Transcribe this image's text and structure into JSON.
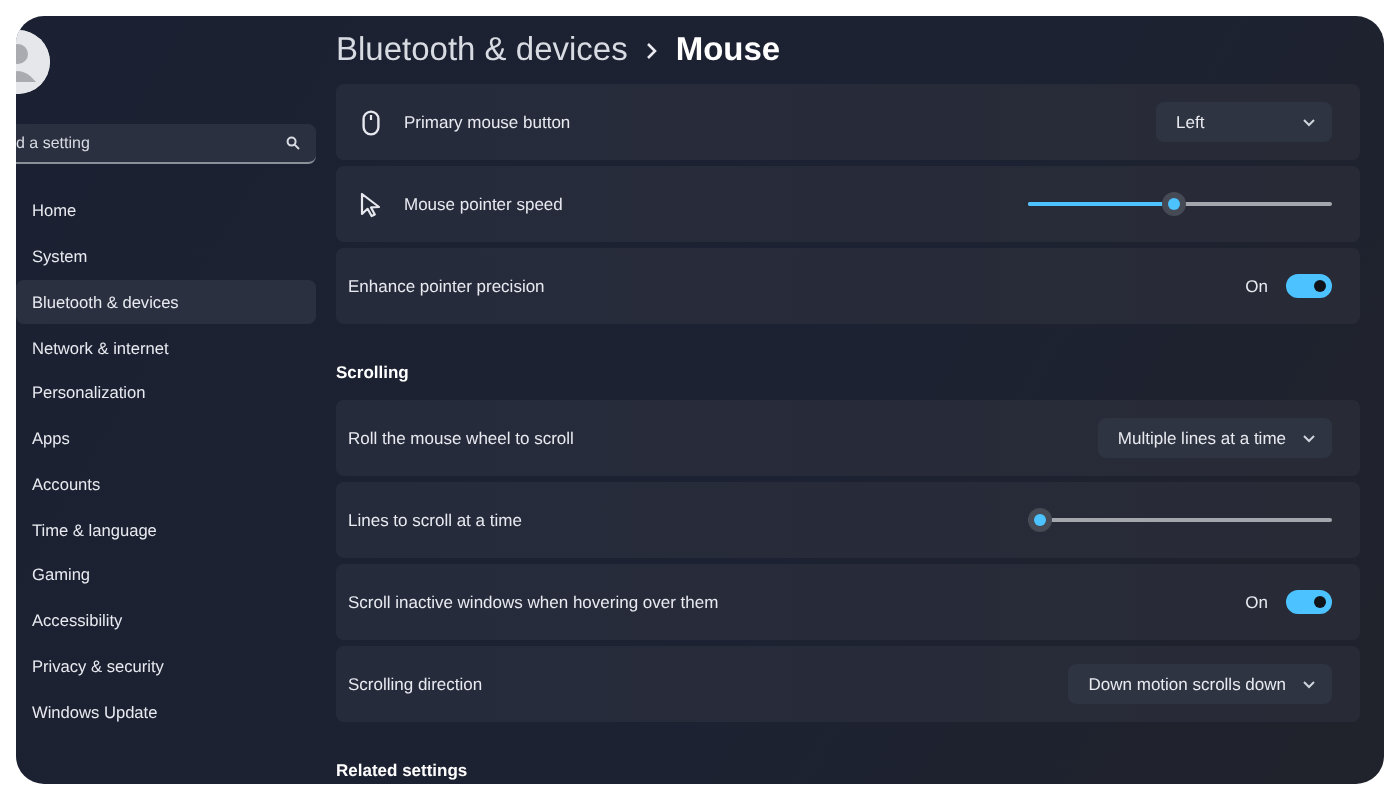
{
  "sidebar": {
    "search": {
      "placeholder": "d a setting"
    },
    "items": [
      {
        "label": "Home",
        "selected": false
      },
      {
        "label": "System",
        "selected": false
      },
      {
        "label": "Bluetooth & devices",
        "selected": true
      },
      {
        "label": "Network & internet",
        "selected": false
      },
      {
        "label": "Personalization",
        "selected": false
      },
      {
        "label": "Apps",
        "selected": false
      },
      {
        "label": "Accounts",
        "selected": false
      },
      {
        "label": "Time & language",
        "selected": false
      },
      {
        "label": "Gaming",
        "selected": false
      },
      {
        "label": "Accessibility",
        "selected": false
      },
      {
        "label": "Privacy & security",
        "selected": false
      },
      {
        "label": "Windows Update",
        "selected": false
      }
    ]
  },
  "breadcrumb": {
    "parent": "Bluetooth & devices",
    "current": "Mouse"
  },
  "sections": [
    {
      "rows": [
        {
          "kind": "dropdown",
          "label": "Primary mouse button",
          "value": "Left"
        },
        {
          "kind": "slider",
          "label": "Mouse pointer speed",
          "level": 0.48
        },
        {
          "kind": "toggle",
          "label": "Enhance pointer precision",
          "state_text": "On",
          "on": true
        }
      ]
    },
    {
      "title": "Scrolling",
      "rows": [
        {
          "kind": "dropdown",
          "label": "Roll the mouse wheel to scroll",
          "value": "Multiple lines at a time"
        },
        {
          "kind": "slider",
          "label": "Lines to scroll at a time",
          "level": 0.04
        },
        {
          "kind": "toggle",
          "label": "Scroll inactive windows when hovering over them",
          "state_text": "On",
          "on": true
        },
        {
          "kind": "dropdown",
          "label": "Scrolling direction",
          "value": "Down motion scrolls down"
        }
      ]
    },
    {
      "title": "Related settings"
    }
  ]
}
